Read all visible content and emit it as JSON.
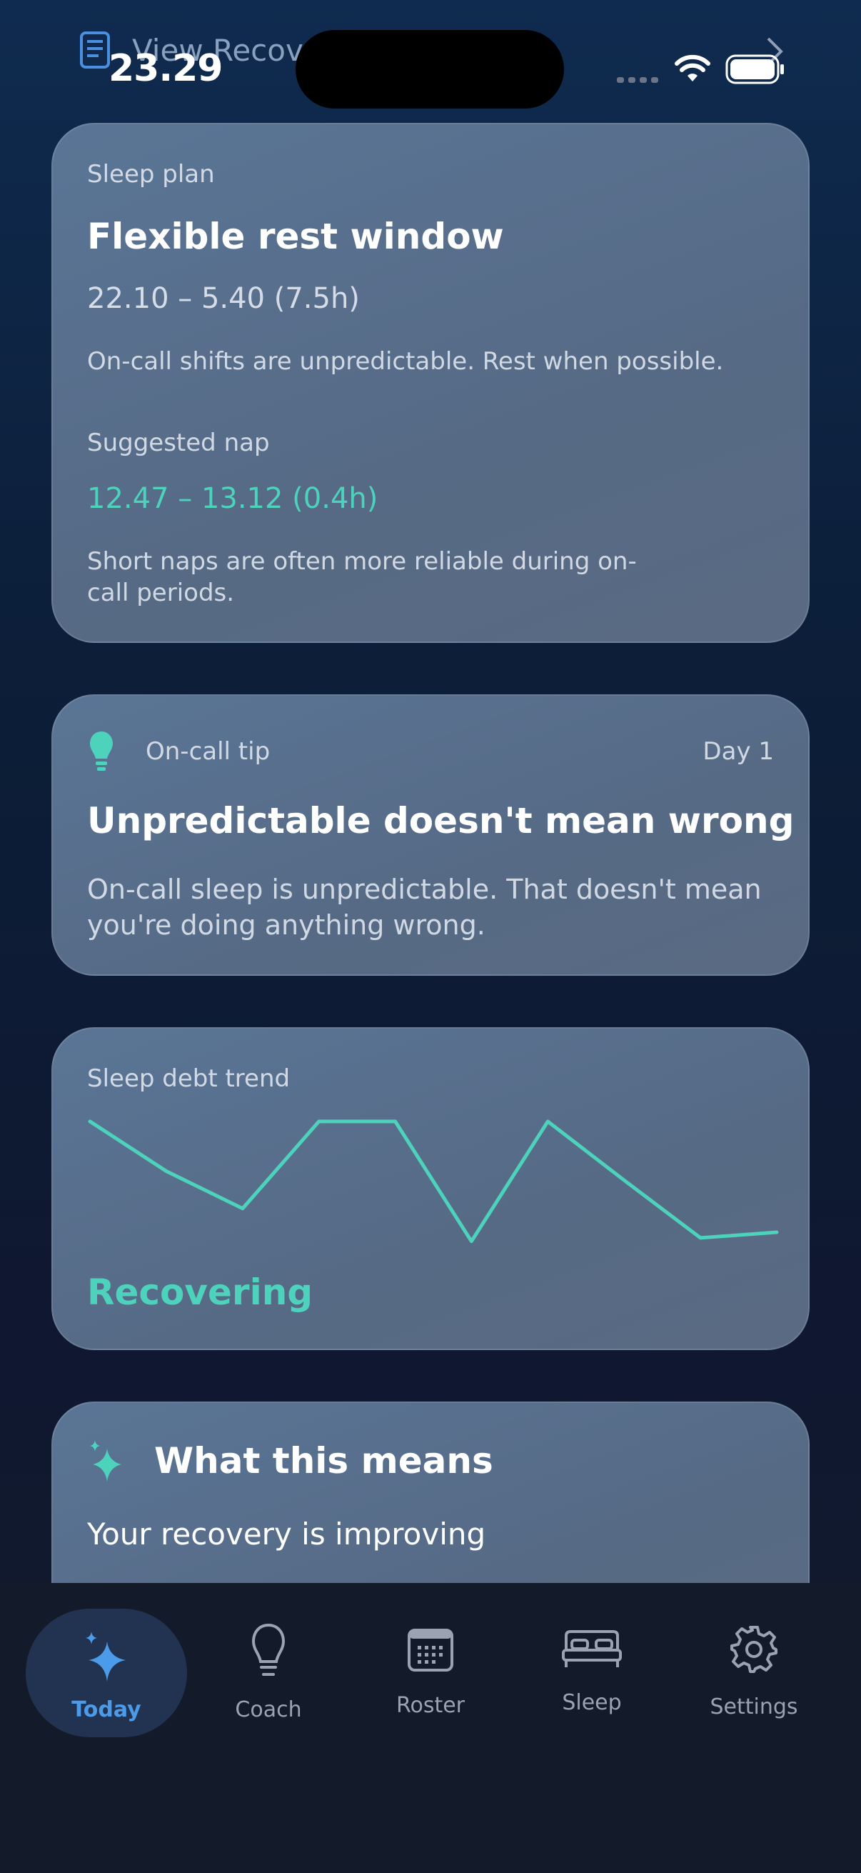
{
  "status_bar": {
    "time": "23.29",
    "peek_text": "View Recove"
  },
  "sleep_plan": {
    "label": "Sleep plan",
    "title": "Flexible rest window",
    "window": "22.10 – 5.40 (7.5h)",
    "note": "On-call shifts are unpredictable. Rest when possible.",
    "nap_label": "Suggested nap",
    "nap_window": "12.47 – 13.12 (0.4h)",
    "nap_note_line1": "Short naps are often more reliable during on-",
    "nap_note_line2": "call periods."
  },
  "tip": {
    "label": "On-call tip",
    "day": "Day 1",
    "title": "Unpredictable doesn't mean wrong",
    "body_line1": "On-call sleep is unpredictable. That doesn't mean",
    "body_line2": "you're doing anything wrong."
  },
  "trend": {
    "label": "Sleep debt trend",
    "status": "Recovering"
  },
  "chart_data": {
    "type": "line",
    "title": "Sleep debt trend",
    "x": [
      1,
      2,
      3,
      4,
      5,
      6,
      7,
      8,
      9,
      10
    ],
    "series": [
      {
        "values": [
          1.0,
          0.56,
          0.23,
          1.0,
          1.0,
          -0.06,
          1.0,
          0.48,
          -0.03,
          0.02
        ]
      }
    ],
    "ylim": [
      -0.1,
      1.05
    ],
    "grid": false,
    "color": "#4dd2bc"
  },
  "meaning": {
    "title": "What this means",
    "body": "Your recovery is improving"
  },
  "nav": {
    "items": [
      {
        "label": "Today",
        "icon": "sparkles-icon",
        "active": true
      },
      {
        "label": "Coach",
        "icon": "lightbulb-icon",
        "active": false
      },
      {
        "label": "Roster",
        "icon": "calendar-icon",
        "active": false
      },
      {
        "label": "Sleep",
        "icon": "bed-icon",
        "active": false
      },
      {
        "label": "Settings",
        "icon": "gear-icon",
        "active": false
      }
    ]
  },
  "colors": {
    "accent_teal": "#4dd2bc",
    "accent_blue": "#4b9be8"
  }
}
